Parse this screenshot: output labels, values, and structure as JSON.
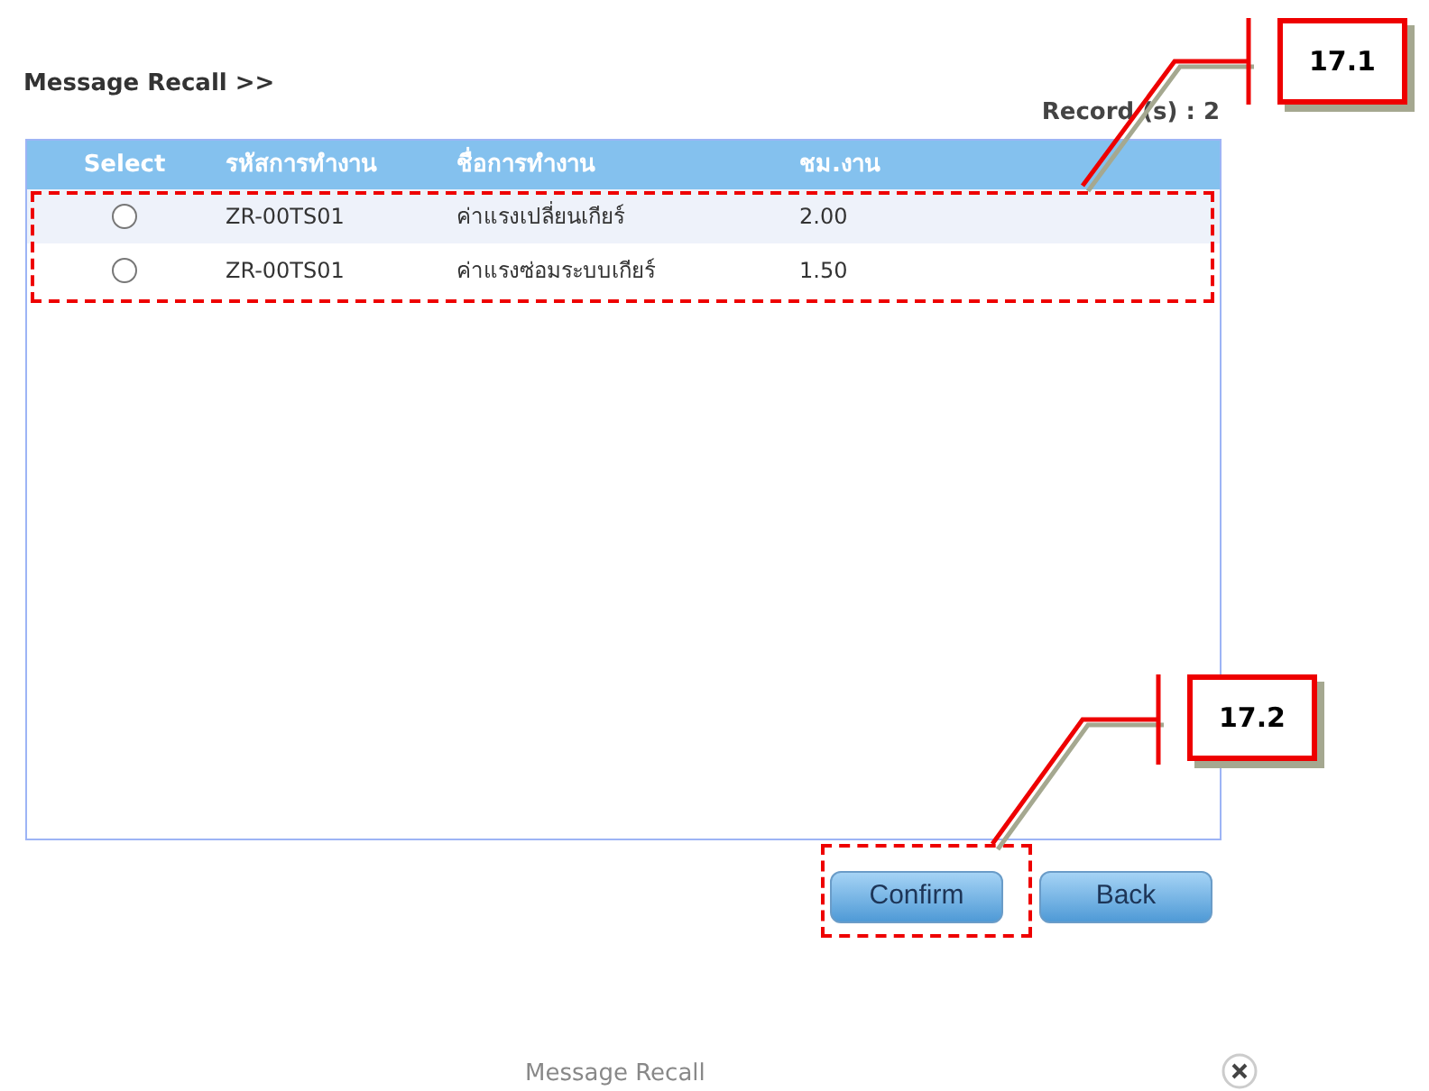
{
  "title": "Message Recall >>",
  "record_count": "Record (s) : 2",
  "table": {
    "columns": [
      "Select",
      "รหัสการทำงาน",
      "ชื่อการทำงาน",
      "ชม.งาน"
    ],
    "rows": [
      {
        "cells": [
          {
            "kind": "radio",
            "selected": false
          },
          "ZR-00TS01",
          "ค่าแรงเปลี่ยนเกียร์",
          "2.00"
        ]
      },
      {
        "cells": [
          {
            "kind": "radio",
            "selected": false
          },
          "ZR-00TS01",
          "ค่าแรงซ่อมระบบเกียร์",
          "1.50"
        ]
      }
    ]
  },
  "buttons": [
    "Confirm",
    "Back"
  ],
  "callouts": [
    {
      "label": "17.1"
    },
    {
      "label": "17.2"
    }
  ],
  "footer": {
    "title": "Message Recall"
  }
}
